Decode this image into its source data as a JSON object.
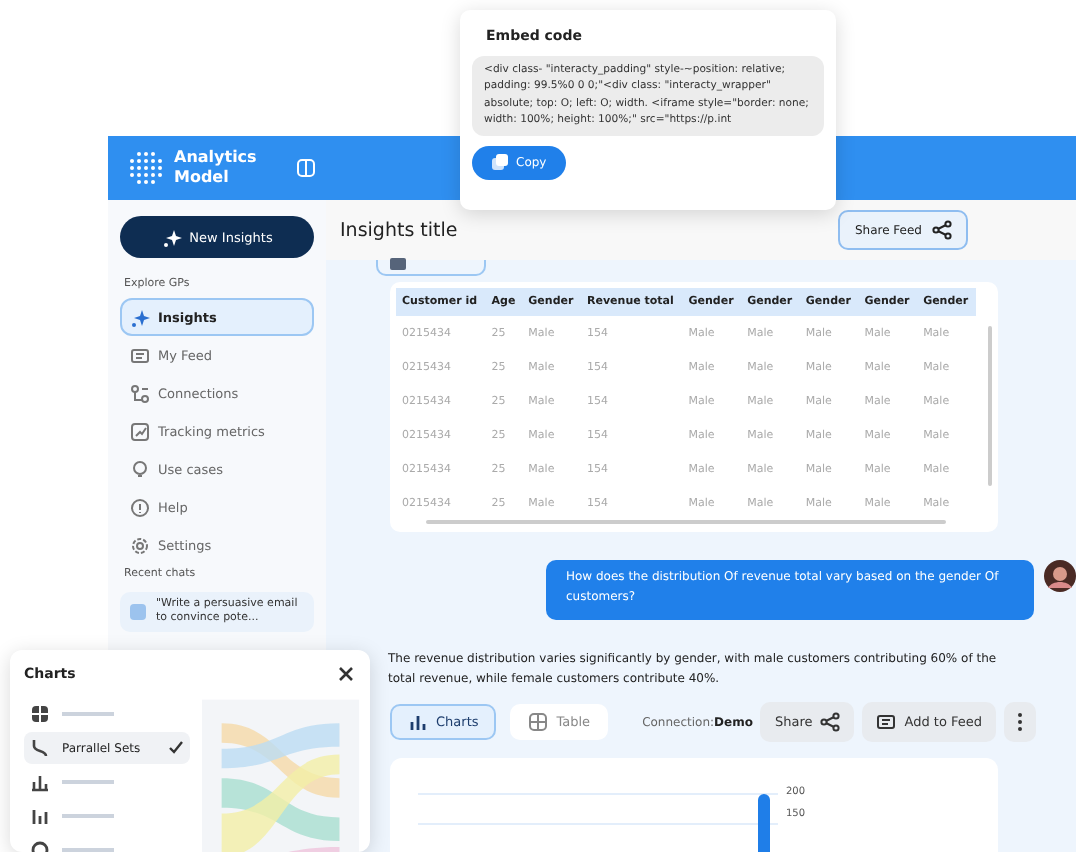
{
  "embed_popup": {
    "title": "Embed code",
    "code": "<div class- \"interacty_padding\" style-~position: relative; padding: 99.5%0 0 0;\"<div class: \"interacty_wrapper\" absolute; top: O; left: O; width. <iframe style=\"border: none; width: 100%; height: 100%;\" src=\"https://p.int",
    "button": "Copy"
  },
  "app": {
    "title": "Analytics Model"
  },
  "sidebar": {
    "new_button": "New Insights",
    "section": "Explore GPs",
    "items": [
      {
        "label": "Insights",
        "selected": true
      },
      {
        "label": "My Feed",
        "selected": false
      },
      {
        "label": "Connections",
        "selected": false
      },
      {
        "label": "Tracking metrics",
        "selected": false
      },
      {
        "label": "Use cases",
        "selected": false
      },
      {
        "label": "Help",
        "selected": false
      },
      {
        "label": "Settings",
        "selected": false
      }
    ],
    "recent_title": "Recent chats",
    "recent_chats": [
      "\"Write a persuasive email to convince pote..."
    ]
  },
  "header": {
    "title": "Insights title",
    "share_button": "Share Feed"
  },
  "table": {
    "columns": [
      "Customer id",
      "Age",
      "Gender",
      "Revenue total",
      "Gender",
      "Gender",
      "Gender",
      "Gender",
      "Gender"
    ],
    "rows": [
      [
        "0215434",
        "25",
        "Male",
        "154",
        "Male",
        "Male",
        "Male",
        "Male",
        "Male"
      ],
      [
        "0215434",
        "25",
        "Male",
        "154",
        "Male",
        "Male",
        "Male",
        "Male",
        "Male"
      ],
      [
        "0215434",
        "25",
        "Male",
        "154",
        "Male",
        "Male",
        "Male",
        "Male",
        "Male"
      ],
      [
        "0215434",
        "25",
        "Male",
        "154",
        "Male",
        "Male",
        "Male",
        "Male",
        "Male"
      ],
      [
        "0215434",
        "25",
        "Male",
        "154",
        "Male",
        "Male",
        "Male",
        "Male",
        "Male"
      ],
      [
        "0215434",
        "25",
        "Male",
        "154",
        "Male",
        "Male",
        "Male",
        "Male",
        "Male"
      ]
    ]
  },
  "question": "How does the distribution Of revenue total vary based on the gender Of customers?",
  "answer": "The revenue distribution varies significantly by gender, with male customers contributing 60% of the total revenue, while female customers contribute 40%.",
  "view_tabs": [
    {
      "label": "Charts",
      "selected": true
    },
    {
      "label": "Table",
      "selected": false
    }
  ],
  "connection": {
    "label": "Connection:",
    "value": "Demo"
  },
  "actions": [
    "Share",
    "Add to Feed"
  ],
  "chart_ticks": [
    "200",
    "150"
  ],
  "charts_panel": {
    "title": "Charts",
    "items": [
      {
        "kind": "placeholder",
        "selected": false
      },
      {
        "kind": "labeled",
        "label": "Parrallel Sets",
        "selected": true
      },
      {
        "kind": "placeholder",
        "selected": false
      },
      {
        "kind": "placeholder",
        "selected": false
      },
      {
        "kind": "placeholder",
        "selected": false
      }
    ]
  }
}
